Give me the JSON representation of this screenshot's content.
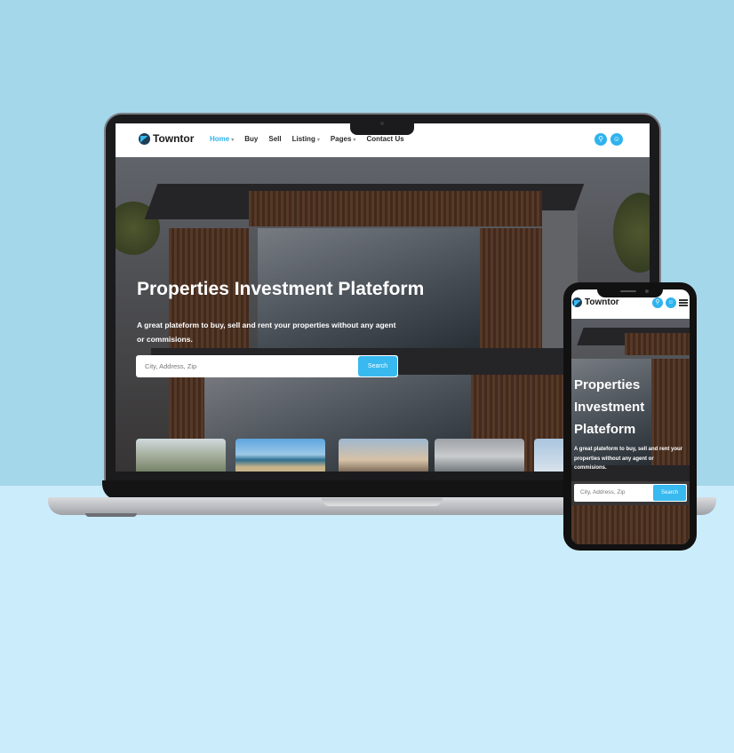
{
  "brand": {
    "name": "Towntor",
    "accent": "#2fb3ef"
  },
  "nav": {
    "items": [
      {
        "label": "Home",
        "dropdown": true,
        "active": true
      },
      {
        "label": "Buy",
        "dropdown": false
      },
      {
        "label": "Sell",
        "dropdown": false
      },
      {
        "label": "Listing",
        "dropdown": true
      },
      {
        "label": "Pages",
        "dropdown": true
      },
      {
        "label": "Contact Us",
        "dropdown": false
      }
    ],
    "icons": [
      "search-icon",
      "user-icon"
    ]
  },
  "hero": {
    "title": "Properties Investment Plateform",
    "subtitle": "A great plateform to buy, sell and rent your properties without any agent or commisions.",
    "search_placeholder": "City, Address, Zip",
    "search_button": "Search"
  },
  "mobile": {
    "title_lines": [
      "Properties",
      "Investment",
      "Plateform"
    ],
    "icons": [
      "search-icon",
      "user-icon",
      "menu-icon"
    ]
  }
}
